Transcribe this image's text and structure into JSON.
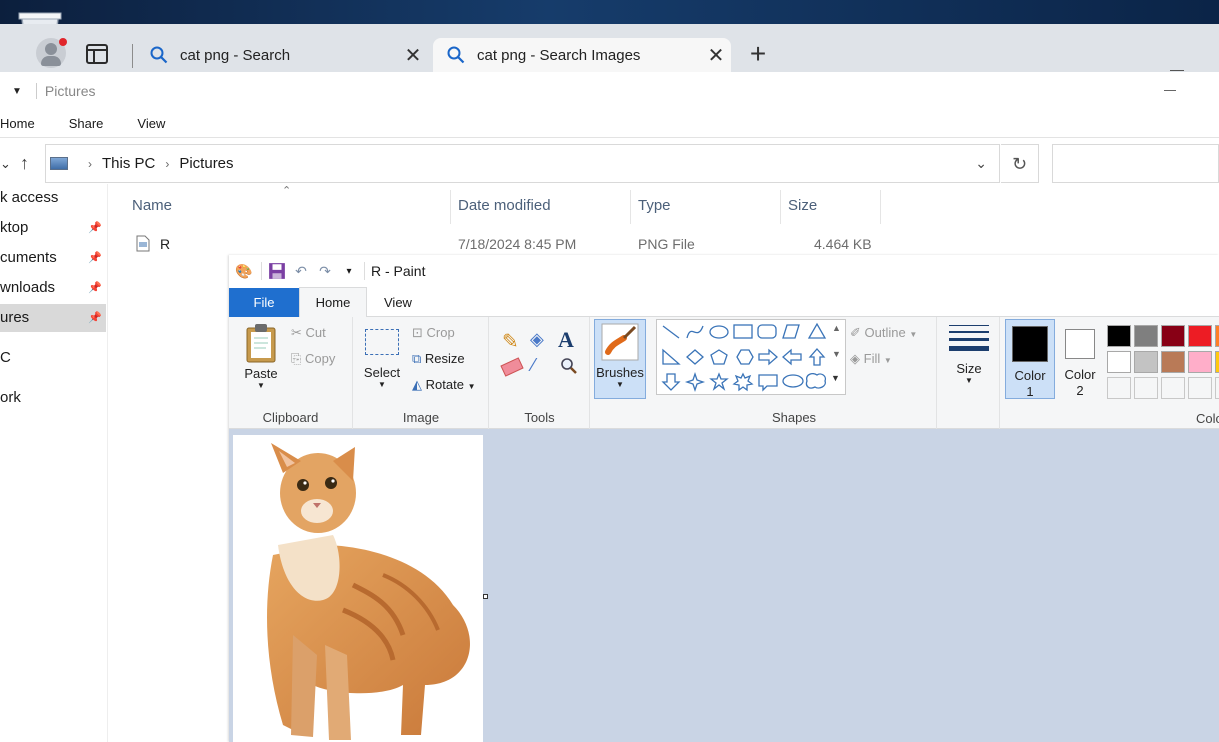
{
  "browser": {
    "tabs": [
      {
        "label": "cat png - Search",
        "active": false
      },
      {
        "label": "cat png - Search Images",
        "active": true
      }
    ],
    "new_tab_symbol": "+",
    "close_symbol": "✕"
  },
  "explorer": {
    "title": "Pictures",
    "menu": [
      "Home",
      "Share",
      "View"
    ],
    "address": {
      "segments": [
        "This PC",
        "Pictures"
      ]
    },
    "sidebar": [
      {
        "label": "k access",
        "pinned": false,
        "selected": false
      },
      {
        "label": "ktop",
        "pinned": true,
        "selected": false
      },
      {
        "label": "cuments",
        "pinned": true,
        "selected": false
      },
      {
        "label": "wnloads",
        "pinned": true,
        "selected": false
      },
      {
        "label": "ures",
        "pinned": true,
        "selected": true
      },
      {
        "label": "C",
        "pinned": false,
        "selected": false
      },
      {
        "label": "ork",
        "pinned": false,
        "selected": false
      }
    ],
    "columns": {
      "name": "Name",
      "date": "Date modified",
      "type": "Type",
      "size": "Size"
    },
    "files": [
      {
        "name": "R",
        "date": "7/18/2024 8:45 PM",
        "type": "PNG File",
        "size": "4.464 KB"
      }
    ]
  },
  "paint": {
    "title": "R - Paint",
    "tabs": {
      "file": "File",
      "home": "Home",
      "view": "View"
    },
    "groups": {
      "clipboard": {
        "label": "Clipboard",
        "paste": "Paste",
        "cut": "Cut",
        "copy": "Copy"
      },
      "image": {
        "label": "Image",
        "select": "Select",
        "crop": "Crop",
        "resize": "Resize",
        "rotate": "Rotate"
      },
      "tools": {
        "label": "Tools"
      },
      "brushes": {
        "label": "Brushes"
      },
      "shapes": {
        "label": "Shapes",
        "outline": "Outline",
        "fill": "Fill"
      },
      "size": {
        "label": "Size"
      },
      "color1": {
        "label": "Color",
        "num": "1"
      },
      "color2": {
        "label": "Color",
        "num": "2"
      },
      "colors": {
        "label": "Colo"
      }
    },
    "palette": [
      "#000000",
      "#7f7f7f",
      "#880015",
      "#ed1c24",
      "#ff7f27",
      "#ffffff",
      "#c3c3c3",
      "#b97a57",
      "#ffaec9",
      "#ffc90e"
    ],
    "accent_color": "#1f6fcf",
    "canvas_bg": "#c9d4e5"
  }
}
